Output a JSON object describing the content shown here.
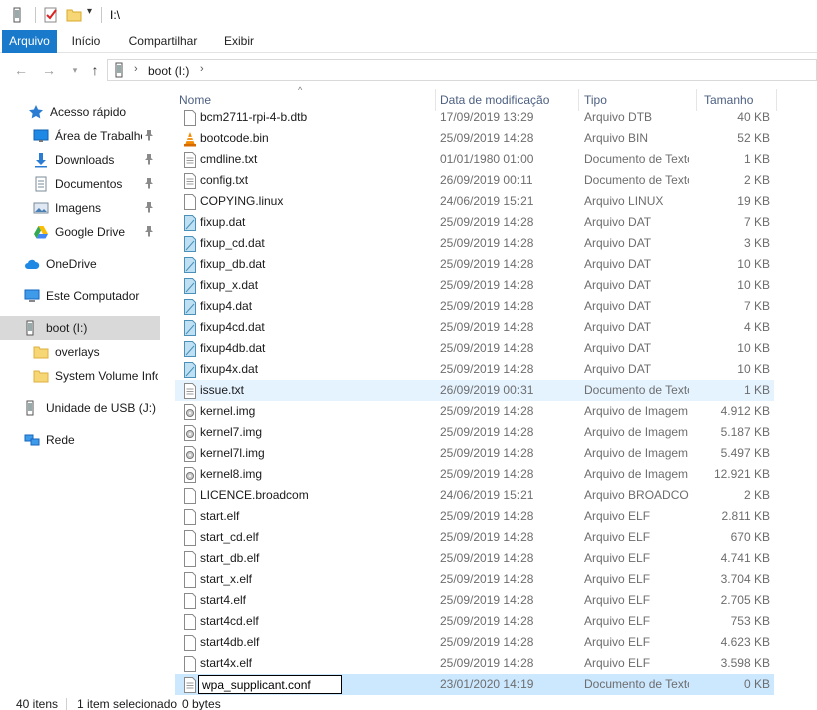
{
  "window": {
    "title": "I:\\"
  },
  "ribbon": {
    "tabs": [
      {
        "label": "Arquivo"
      },
      {
        "label": "Início"
      },
      {
        "label": "Compartilhar"
      },
      {
        "label": "Exibir"
      }
    ]
  },
  "address": {
    "crumbs": [
      "boot (I:)"
    ]
  },
  "nav": {
    "items": [
      {
        "label": "Acesso rápido",
        "icon": "star-icon",
        "pinned": false
      },
      {
        "label": "Área de Trabalho",
        "icon": "desktop-icon",
        "pinned": true
      },
      {
        "label": "Downloads",
        "icon": "download-icon",
        "pinned": true
      },
      {
        "label": "Documentos",
        "icon": "documents-icon",
        "pinned": true
      },
      {
        "label": "Imagens",
        "icon": "pictures-icon",
        "pinned": true
      },
      {
        "label": "Google Drive",
        "icon": "google-drive-icon",
        "pinned": true
      },
      {
        "label": "OneDrive",
        "icon": "cloud-icon",
        "pinned": false
      },
      {
        "label": "Este Computador",
        "icon": "computer-icon",
        "pinned": false
      },
      {
        "label": "boot (I:)",
        "icon": "usb-drive-icon",
        "pinned": false,
        "selected": true
      },
      {
        "label": "overlays",
        "icon": "folder-icon",
        "pinned": false
      },
      {
        "label": "System Volume Informa",
        "icon": "folder-icon",
        "pinned": false
      },
      {
        "label": "Unidade de USB (J:)",
        "icon": "usb-drive-icon",
        "pinned": false
      },
      {
        "label": "Rede",
        "icon": "network-icon",
        "pinned": false
      }
    ]
  },
  "columns": {
    "name": "Nome",
    "date": "Data de modificação",
    "type": "Tipo",
    "size": "Tamanho"
  },
  "files": [
    {
      "name": "bcm2711-rpi-4-b.dtb",
      "date": "17/09/2019 13:29",
      "type": "Arquivo DTB",
      "size": "40 KB",
      "icon": "file-icon"
    },
    {
      "name": "bootcode.bin",
      "date": "25/09/2019 14:28",
      "type": "Arquivo BIN",
      "size": "52 KB",
      "icon": "vlc-cone-icon"
    },
    {
      "name": "cmdline.txt",
      "date": "01/01/1980 01:00",
      "type": "Documento de Texto",
      "size": "1 KB",
      "icon": "text-file-icon"
    },
    {
      "name": "config.txt",
      "date": "26/09/2019 00:11",
      "type": "Documento de Texto",
      "size": "2 KB",
      "icon": "text-file-icon"
    },
    {
      "name": "COPYING.linux",
      "date": "24/06/2019 15:21",
      "type": "Arquivo LINUX",
      "size": "19 KB",
      "icon": "file-icon"
    },
    {
      "name": "fixup.dat",
      "date": "25/09/2019 14:28",
      "type": "Arquivo DAT",
      "size": "7 KB",
      "icon": "dat-file-icon"
    },
    {
      "name": "fixup_cd.dat",
      "date": "25/09/2019 14:28",
      "type": "Arquivo DAT",
      "size": "3 KB",
      "icon": "dat-file-icon"
    },
    {
      "name": "fixup_db.dat",
      "date": "25/09/2019 14:28",
      "type": "Arquivo DAT",
      "size": "10 KB",
      "icon": "dat-file-icon"
    },
    {
      "name": "fixup_x.dat",
      "date": "25/09/2019 14:28",
      "type": "Arquivo DAT",
      "size": "10 KB",
      "icon": "dat-file-icon"
    },
    {
      "name": "fixup4.dat",
      "date": "25/09/2019 14:28",
      "type": "Arquivo DAT",
      "size": "7 KB",
      "icon": "dat-file-icon"
    },
    {
      "name": "fixup4cd.dat",
      "date": "25/09/2019 14:28",
      "type": "Arquivo DAT",
      "size": "4 KB",
      "icon": "dat-file-icon"
    },
    {
      "name": "fixup4db.dat",
      "date": "25/09/2019 14:28",
      "type": "Arquivo DAT",
      "size": "10 KB",
      "icon": "dat-file-icon"
    },
    {
      "name": "fixup4x.dat",
      "date": "25/09/2019 14:28",
      "type": "Arquivo DAT",
      "size": "10 KB",
      "icon": "dat-file-icon"
    },
    {
      "name": "issue.txt",
      "date": "26/09/2019 00:31",
      "type": "Documento de Texto",
      "size": "1 KB",
      "icon": "text-file-icon",
      "hover": true
    },
    {
      "name": "kernel.img",
      "date": "25/09/2019 14:28",
      "type": "Arquivo de Imagem de Disco",
      "size": "4.912 KB",
      "icon": "disk-image-icon"
    },
    {
      "name": "kernel7.img",
      "date": "25/09/2019 14:28",
      "type": "Arquivo de Imagem de Disco",
      "size": "5.187 KB",
      "icon": "disk-image-icon"
    },
    {
      "name": "kernel7l.img",
      "date": "25/09/2019 14:28",
      "type": "Arquivo de Imagem de Disco",
      "size": "5.497 KB",
      "icon": "disk-image-icon"
    },
    {
      "name": "kernel8.img",
      "date": "25/09/2019 14:28",
      "type": "Arquivo de Imagem de Disco",
      "size": "12.921 KB",
      "icon": "disk-image-icon"
    },
    {
      "name": "LICENCE.broadcom",
      "date": "24/06/2019 15:21",
      "type": "Arquivo BROADCOM",
      "size": "2 KB",
      "icon": "file-icon"
    },
    {
      "name": "start.elf",
      "date": "25/09/2019 14:28",
      "type": "Arquivo ELF",
      "size": "2.811 KB",
      "icon": "file-icon"
    },
    {
      "name": "start_cd.elf",
      "date": "25/09/2019 14:28",
      "type": "Arquivo ELF",
      "size": "670 KB",
      "icon": "file-icon"
    },
    {
      "name": "start_db.elf",
      "date": "25/09/2019 14:28",
      "type": "Arquivo ELF",
      "size": "4.741 KB",
      "icon": "file-icon"
    },
    {
      "name": "start_x.elf",
      "date": "25/09/2019 14:28",
      "type": "Arquivo ELF",
      "size": "3.704 KB",
      "icon": "file-icon"
    },
    {
      "name": "start4.elf",
      "date": "25/09/2019 14:28",
      "type": "Arquivo ELF",
      "size": "2.705 KB",
      "icon": "file-icon"
    },
    {
      "name": "start4cd.elf",
      "date": "25/09/2019 14:28",
      "type": "Arquivo ELF",
      "size": "753 KB",
      "icon": "file-icon"
    },
    {
      "name": "start4db.elf",
      "date": "25/09/2019 14:28",
      "type": "Arquivo ELF",
      "size": "4.623 KB",
      "icon": "file-icon"
    },
    {
      "name": "start4x.elf",
      "date": "25/09/2019 14:28",
      "type": "Arquivo ELF",
      "size": "3.598 KB",
      "icon": "file-icon"
    },
    {
      "name": "wpa_supplicant.conf",
      "date": "23/01/2020 14:19",
      "type": "Documento de Texto",
      "size": "0 KB",
      "icon": "text-file-icon",
      "selected": true,
      "renaming": true
    }
  ],
  "status": {
    "count": "40 itens",
    "selection": "1 item selecionado",
    "bytes": "0 bytes"
  },
  "colors": {
    "accent": "#1979ca",
    "selection": "#cce8ff",
    "hover": "#e5f3ff",
    "header_text": "#4d6082"
  }
}
